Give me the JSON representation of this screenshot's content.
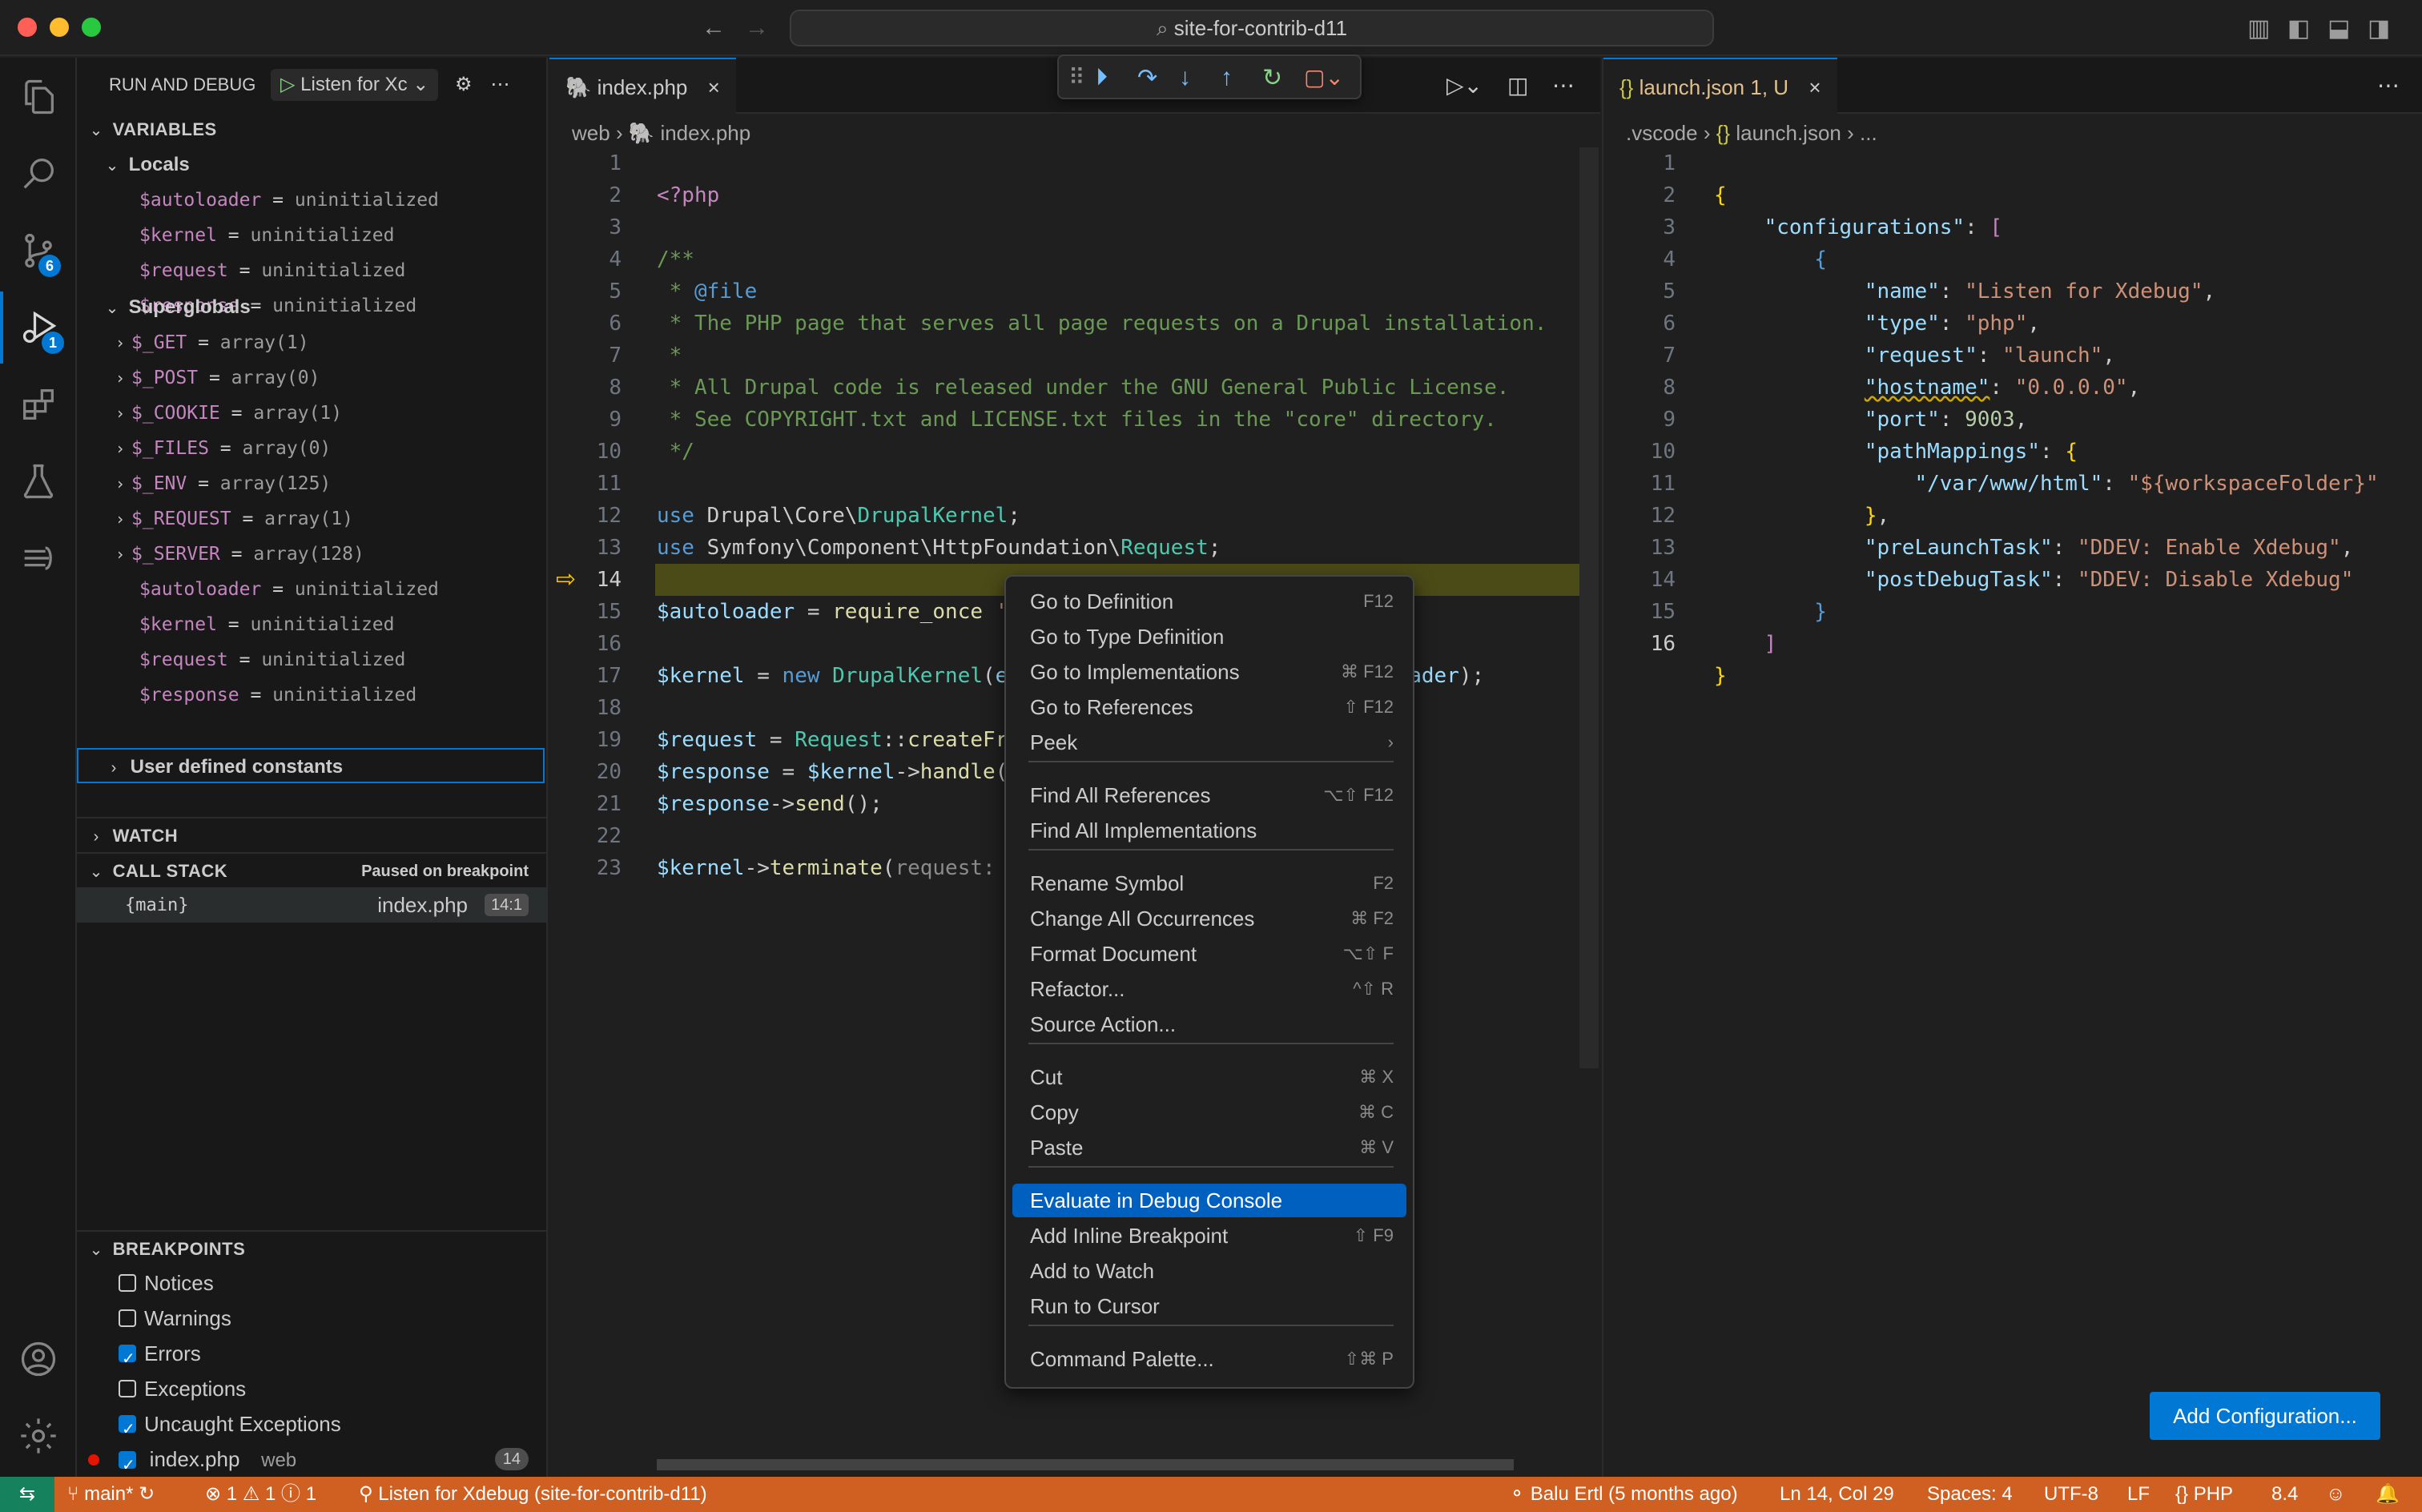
{
  "window": {
    "search_text": "site-for-contrib-d11"
  },
  "sidebar": {
    "title": "RUN AND DEBUG",
    "config": "Listen for Xc",
    "variables_title": "VARIABLES",
    "locals_title": "Locals",
    "locals": [
      {
        "name": "$autoloader",
        "value": "uninitialized"
      },
      {
        "name": "$kernel",
        "value": "uninitialized"
      },
      {
        "name": "$request",
        "value": "uninitialized"
      },
      {
        "name": "$response",
        "value": "uninitialized"
      }
    ],
    "superglobals_title": "Superglobals",
    "superglobals": [
      {
        "name": "$_GET",
        "value": "array(1)"
      },
      {
        "name": "$_POST",
        "value": "array(0)"
      },
      {
        "name": "$_COOKIE",
        "value": "array(1)"
      },
      {
        "name": "$_FILES",
        "value": "array(0)"
      },
      {
        "name": "$_ENV",
        "value": "array(125)"
      },
      {
        "name": "$_REQUEST",
        "value": "array(1)"
      },
      {
        "name": "$_SERVER",
        "value": "array(128)"
      }
    ],
    "superglobal_vars": [
      {
        "name": "$autoloader",
        "value": "uninitialized"
      },
      {
        "name": "$kernel",
        "value": "uninitialized"
      },
      {
        "name": "$request",
        "value": "uninitialized"
      },
      {
        "name": "$response",
        "value": "uninitialized"
      }
    ],
    "user_constants": "User defined constants",
    "watch_title": "WATCH",
    "callstack_title": "CALL STACK",
    "callstack_status": "Paused on breakpoint",
    "callstack_frame": {
      "name": "{main}",
      "file": "index.php",
      "pos": "14:1"
    },
    "breakpoints_title": "BREAKPOINTS",
    "breakpoints": [
      {
        "label": "Notices",
        "checked": false
      },
      {
        "label": "Warnings",
        "checked": false
      },
      {
        "label": "Errors",
        "checked": true
      },
      {
        "label": "Exceptions",
        "checked": false
      },
      {
        "label": "Uncaught Exceptions",
        "checked": true
      }
    ],
    "file_breakpoint": {
      "file": "index.php",
      "dir": "web",
      "line": "14"
    }
  },
  "activity": {
    "scm_badge": "6",
    "debug_badge": "1"
  },
  "editor_left": {
    "tab": "index.php",
    "breadcrumb": [
      "web",
      "index.php"
    ],
    "lines": [
      "1",
      "2",
      "3",
      "4",
      "5",
      "6",
      "7",
      "8",
      "9",
      "10",
      "11",
      "12",
      "13",
      "14",
      "15",
      "16",
      "17",
      "18",
      "19",
      "20",
      "21",
      "22",
      "23"
    ]
  },
  "editor_right": {
    "tab": "launch.json",
    "tab_status": "1, U",
    "breadcrumb": [
      ".vscode",
      "launch.json",
      "..."
    ],
    "lines": [
      "1",
      "2",
      "3",
      "4",
      "5",
      "6",
      "7",
      "8",
      "9",
      "10",
      "11",
      "12",
      "13",
      "14",
      "15",
      "16"
    ],
    "add_config": "Add Configuration..."
  },
  "context_menu": {
    "items": [
      {
        "label": "Go to Definition",
        "shortcut": "F12"
      },
      {
        "label": "Go to Type Definition",
        "shortcut": ""
      },
      {
        "label": "Go to Implementations",
        "shortcut": "⌘ F12"
      },
      {
        "label": "Go to References",
        "shortcut": "⇧ F12"
      },
      {
        "label": "Peek",
        "shortcut": "›"
      },
      {
        "label": "Find All References",
        "shortcut": "⌥⇧ F12"
      },
      {
        "label": "Find All Implementations",
        "shortcut": ""
      },
      {
        "label": "Rename Symbol",
        "shortcut": "F2"
      },
      {
        "label": "Change All Occurrences",
        "shortcut": "⌘ F2"
      },
      {
        "label": "Format Document",
        "shortcut": "⌥⇧ F"
      },
      {
        "label": "Refactor...",
        "shortcut": "^⇧ R"
      },
      {
        "label": "Source Action...",
        "shortcut": ""
      },
      {
        "label": "Cut",
        "shortcut": "⌘ X"
      },
      {
        "label": "Copy",
        "shortcut": "⌘ C"
      },
      {
        "label": "Paste",
        "shortcut": "⌘ V"
      },
      {
        "label": "Evaluate in Debug Console",
        "shortcut": ""
      },
      {
        "label": "Add Inline Breakpoint",
        "shortcut": "⇧ F9"
      },
      {
        "label": "Add to Watch",
        "shortcut": ""
      },
      {
        "label": "Run to Cursor",
        "shortcut": ""
      },
      {
        "label": "Command Palette...",
        "shortcut": "⇧⌘ P"
      }
    ]
  },
  "statusbar": {
    "branch": "main*",
    "errors": "1",
    "warnings": "1",
    "infos": "1",
    "debug_session": "Listen for Xdebug (site-for-contrib-d11)",
    "blame": "Balu Ertl (5 months ago)",
    "cursor": "Ln 14, Col 29",
    "spaces": "Spaces: 4",
    "encoding": "UTF-8",
    "eol": "LF",
    "language": "PHP",
    "version": "8.4"
  }
}
